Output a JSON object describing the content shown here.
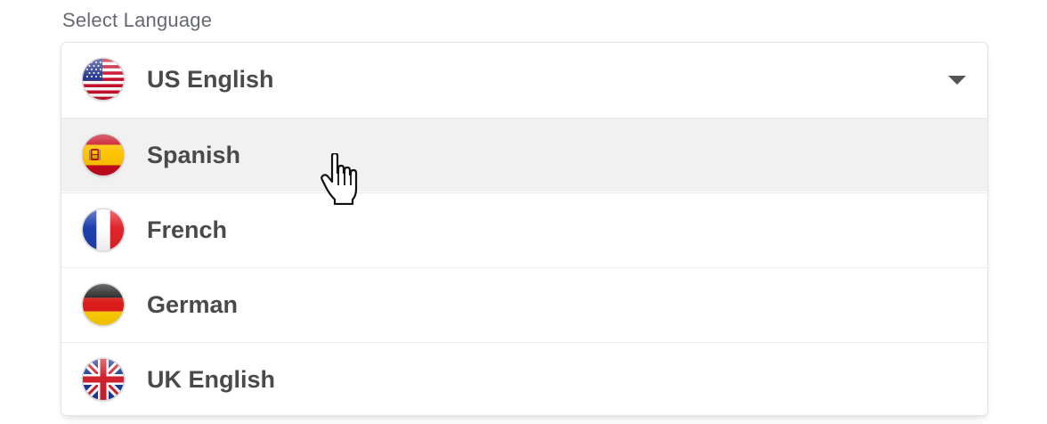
{
  "label": "Select Language",
  "selected": {
    "label": "US English",
    "flag_icon": "us-flag-icon"
  },
  "options": [
    {
      "label": "Spanish",
      "flag_icon": "spain-flag-icon",
      "hovered": true
    },
    {
      "label": "French",
      "flag_icon": "france-flag-icon"
    },
    {
      "label": "German",
      "flag_icon": "germany-flag-icon"
    },
    {
      "label": "UK English",
      "flag_icon": "uk-flag-icon"
    }
  ],
  "caret_icon": "caret-down-icon",
  "cursor_icon": "hand-pointer-cursor-icon",
  "colors": {
    "text": "#4a4a4a",
    "label": "#666a70",
    "hover_bg": "#f1f1f1",
    "border": "#e4e4e4"
  }
}
